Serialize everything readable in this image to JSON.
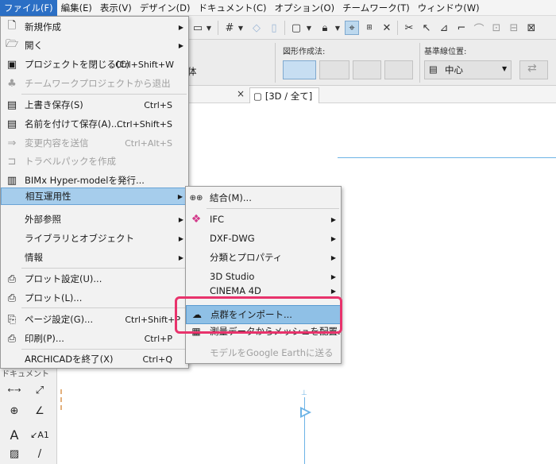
{
  "menubar": {
    "items": [
      "ファイル(F)",
      "編集(E)",
      "表示(V)",
      "デザイン(D)",
      "ドキュメント(C)",
      "オプション(O)",
      "チームワーク(T)",
      "ウィンドウ(W)"
    ]
  },
  "infobox": {
    "shape_label": "図形作成法:",
    "ref_label": "基準線位置:",
    "ref_value": "中心",
    "left_value": "体"
  },
  "tab": {
    "close": "×",
    "label": "[3D / 全て]"
  },
  "palette": {
    "title": "ドキュメント"
  },
  "file_menu": {
    "items": [
      {
        "icon": "new-doc-icon",
        "label": "新規作成",
        "shortcut": "",
        "arrow": "▶",
        "disabled": false
      },
      {
        "icon": "open-icon",
        "label": "開く",
        "shortcut": "",
        "arrow": "▶",
        "disabled": false
      },
      {
        "icon": "close-project-icon",
        "label": "プロジェクトを閉じる(C)",
        "shortcut": "Ctrl+Shift+W",
        "arrow": "",
        "disabled": false
      },
      {
        "icon": "teamwork-exit-icon",
        "label": "チームワークプロジェクトから退出",
        "shortcut": "",
        "arrow": "",
        "disabled": true
      },
      {
        "icon": "save-icon",
        "label": "上書き保存(S)",
        "shortcut": "Ctrl+S",
        "arrow": "",
        "disabled": false
      },
      {
        "icon": "save-as-icon",
        "label": "名前を付けて保存(A)...",
        "shortcut": "Ctrl+Shift+S",
        "arrow": "",
        "disabled": false
      },
      {
        "icon": "send-changes-icon",
        "label": "変更内容を送信",
        "shortcut": "Ctrl+Alt+S",
        "arrow": "",
        "disabled": true
      },
      {
        "icon": "travel-pack-icon",
        "label": "トラベルパックを作成",
        "shortcut": "",
        "arrow": "",
        "disabled": true
      },
      {
        "icon": "bimx-icon",
        "label": "BIMx Hyper-modelを発行...",
        "shortcut": "",
        "arrow": "",
        "disabled": false
      },
      {
        "icon": "",
        "label": "相互運用性",
        "shortcut": "",
        "arrow": "▶",
        "disabled": false
      },
      {
        "icon": "",
        "label": "外部参照",
        "shortcut": "",
        "arrow": "▶",
        "disabled": false
      },
      {
        "icon": "",
        "label": "ライブラリとオブジェクト",
        "shortcut": "",
        "arrow": "▶",
        "disabled": false
      },
      {
        "icon": "",
        "label": "情報",
        "shortcut": "",
        "arrow": "▶",
        "disabled": false
      },
      {
        "icon": "plot-settings-icon",
        "label": "プロット設定(U)...",
        "shortcut": "",
        "arrow": "",
        "disabled": false
      },
      {
        "icon": "plot-icon",
        "label": "プロット(L)...",
        "shortcut": "",
        "arrow": "",
        "disabled": false
      },
      {
        "icon": "page-setup-icon",
        "label": "ページ設定(G)...",
        "shortcut": "Ctrl+Shift+P",
        "arrow": "",
        "disabled": false
      },
      {
        "icon": "print-icon",
        "label": "印刷(P)...",
        "shortcut": "Ctrl+P",
        "arrow": "",
        "disabled": false
      },
      {
        "icon": "",
        "label": "ARCHICADを終了(X)",
        "shortcut": "Ctrl+Q",
        "arrow": "",
        "disabled": false
      }
    ]
  },
  "interop_menu": {
    "items": [
      {
        "icon": "merge-icon",
        "label": "結合(M)...",
        "arrow": "",
        "disabled": false
      },
      {
        "icon": "ifc-icon",
        "label": "IFC",
        "arrow": "▶",
        "disabled": false
      },
      {
        "icon": "",
        "label": "DXF-DWG",
        "arrow": "▶",
        "disabled": false
      },
      {
        "icon": "",
        "label": "分類とプロパティ",
        "arrow": "▶",
        "disabled": false
      },
      {
        "icon": "",
        "label": "3D Studio",
        "arrow": "▶",
        "disabled": false
      },
      {
        "icon": "",
        "label": "CINEMA 4D",
        "arrow": "▶",
        "disabled": false
      },
      {
        "icon": "point-cloud-icon",
        "label": "点群をインポート...",
        "arrow": "",
        "disabled": false
      },
      {
        "icon": "survey-mesh-icon",
        "label": "測量データからメッシュを配置...",
        "arrow": "",
        "disabled": false
      },
      {
        "icon": "",
        "label": "モデルをGoogle Earthに送る",
        "arrow": "",
        "disabled": true
      }
    ]
  }
}
